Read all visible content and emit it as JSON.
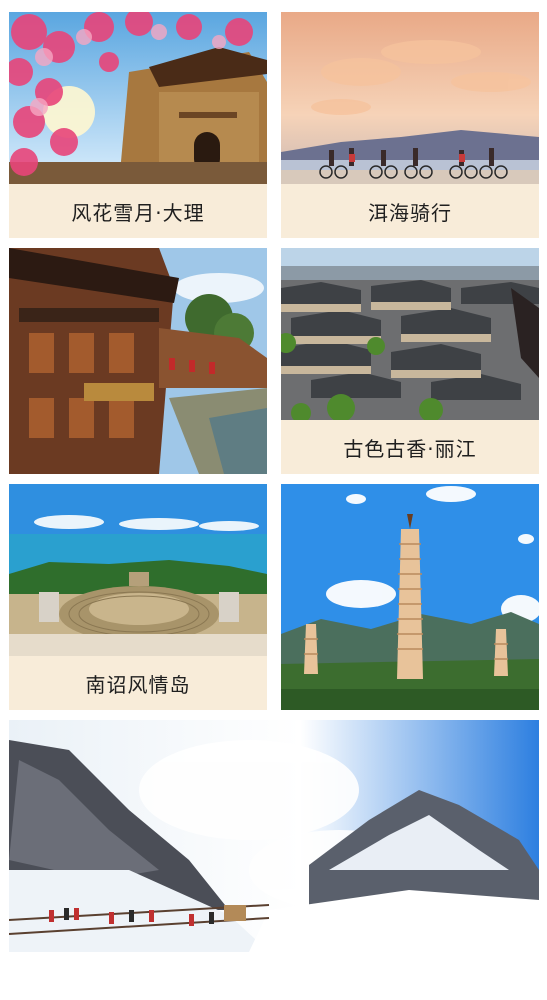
{
  "colors": {
    "page_bg": "#ffffff",
    "caption_bg": "#f8ecd9",
    "caption_text": "#1f1f1f"
  },
  "cards": [
    {
      "caption": "风花雪月·大理",
      "image": "dali-gate-cherry-blossom-photo"
    },
    {
      "caption": "洱海骑行",
      "image": "erhai-lake-cycling-sunset-photo"
    },
    {
      "caption": "",
      "image": "old-town-wooden-buildings-canal-photo"
    },
    {
      "caption": "古色古香·丽江",
      "image": "lijiang-old-town-rooftops-photo"
    },
    {
      "caption": "南诏风情岛",
      "image": "nanzhao-island-amphitheater-photo"
    },
    {
      "caption": "",
      "image": "three-pagodas-blue-sky-photo"
    },
    {
      "caption": "",
      "image": "jade-dragon-snow-mountain-photo"
    }
  ]
}
